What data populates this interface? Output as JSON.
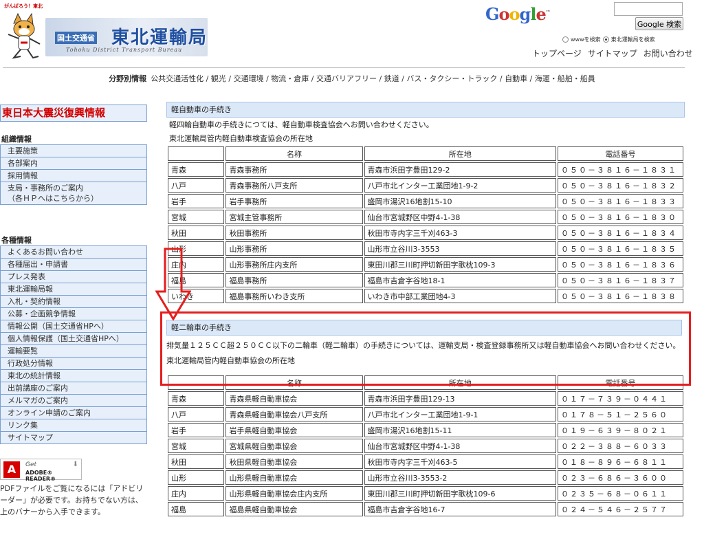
{
  "header": {
    "tagline": "がんばろう！東北",
    "logo_ministry": "国土交通省",
    "logo_name": "東北運輸局",
    "logo_english": "Tohoku District Transport Bureau",
    "google_logo": [
      "G",
      "o",
      "o",
      "g",
      "l",
      "e"
    ],
    "google_tm": "™",
    "search_placeholder": "",
    "search_button": "Google 検索",
    "search_option_www": "wwwを検索",
    "search_option_site": "東北運輸局を検索",
    "top_links": [
      "トップページ",
      "サイトマップ",
      "お問い合わせ"
    ]
  },
  "category_nav": {
    "label": "分野別情報",
    "items": [
      "公共交通活性化",
      "観光",
      "交通環境",
      "物流・倉庫",
      "交通バリアフリー",
      "鉄道",
      "バス・タクシー・トラック",
      "自動車",
      "海運・船舶・船員"
    ]
  },
  "sidebar": {
    "quake_banner": "東日本大震災復興情報",
    "groups": [
      {
        "title": "組織情報",
        "items": [
          "主要施策",
          "各部案内",
          "採用情報",
          "支局・事務所のご案内\n（各ＨＰへはこちらから）"
        ]
      },
      {
        "title": "各種情報",
        "items": [
          "よくあるお問い合わせ",
          "各種届出・申請書",
          "プレス発表",
          "東北運輸局報",
          "入札・契約情報",
          "公募・企画競争情報",
          "情報公開（国土交通省HPへ）",
          "個人情報保護（国土交通省HPへ）",
          "運輸要覧",
          "行政処分情報",
          "東北の統計情報",
          "出前講座のご案内",
          "メルマガのご案内",
          "オンライン申請のご案内",
          "リンク集",
          "サイトマップ"
        ]
      }
    ],
    "adobe": {
      "get": "Get",
      "reader": "ADOBE® READER®"
    },
    "pdf_note": "PDFファイルをご覧になるには「アドビリーダー」が必要です。お持ちでない方は、上のバナーから入手できます。"
  },
  "section1": {
    "title": "軽自動車の手続き",
    "note1": "軽四輪自動車の手続きにつては、軽自動車検査協会へお問い合わせください。",
    "note2": "東北運輸局管内軽自動車検査協会の所在地",
    "headers": [
      "",
      "名称",
      "所在地",
      "電話番号"
    ],
    "rows": [
      [
        "青森",
        "青森事務所",
        "青森市浜田字豊田129-2",
        "０５０－３８１６－１８３１"
      ],
      [
        "八戸",
        "青森事務所八戸支所",
        "八戸市北インター工業団地1-9-2",
        "０５０－３８１６－１８３２"
      ],
      [
        "岩手",
        "岩手事務所",
        "盛岡市湯沢16地割15-10",
        "０５０－３８１６－１８３３"
      ],
      [
        "宮城",
        "宮城主管事務所",
        "仙台市宮城野区中野4-1-38",
        "０５０－３８１６－１８３０"
      ],
      [
        "秋田",
        "秋田事務所",
        "秋田市寺内字三千刈463-3",
        "０５０－３８１６－１８３４"
      ],
      [
        "山形",
        "山形事務所",
        "山形市立谷川3-3553",
        "０５０－３８１６－１８３５"
      ],
      [
        "庄内",
        "山形事務所庄内支所",
        "東田川郡三川町押切新田字歌枕109-3",
        "０５０－３８１６－１８３６"
      ],
      [
        "福島",
        "福島事務所",
        "福島市吉倉字谷地18-1",
        "０５０－３８１６－１８３７"
      ],
      [
        "いわき",
        "福島事務所いわき支所",
        "いわき市中部工業団地4-3",
        "０５０－３８１６－１８３８"
      ]
    ]
  },
  "section2": {
    "title": "軽二輪車の手続き",
    "note1": "排気量１２５ＣＣ超２５０ＣＣ以下の二輪車（軽二輪車）の手続きについては、運輸支局・検査登録事務所又は軽自動車協会へお問い合わせください。",
    "note2": "東北運輸局管内軽自動車協会の所在地",
    "headers": [
      "",
      "名称",
      "所在地",
      "電話番号"
    ],
    "rows": [
      [
        "青森",
        "青森県軽自動車協会",
        "青森市浜田字豊田129-13",
        "０１７－７３９－０４４１"
      ],
      [
        "八戸",
        "青森県軽自動車協会八戸支所",
        "八戸市北インター工業団地1-9-1",
        "０１７８－５１－２５６０"
      ],
      [
        "岩手",
        "岩手県軽自動車協会",
        "盛岡市湯沢16地割15-11",
        "０１９－６３９－８０２１"
      ],
      [
        "宮城",
        "宮城県軽自動車協会",
        "仙台市宮城野区中野4-1-38",
        "０２２－３８８－６０３３"
      ],
      [
        "秋田",
        "秋田県軽自動車協会",
        "秋田市寺内字三千刈463-5",
        "０１８－８９６－６８１１"
      ],
      [
        "山形",
        "山形県軽自動車協会",
        "山形市立谷川3-3553-2",
        "０２３－６８６－３６００"
      ],
      [
        "庄内",
        "山形県軽自動車協会庄内支所",
        "東田川郡三川町押切新田字歌枕109-6",
        "０２３５－６８－０６１１"
      ],
      [
        "福島",
        "福島県軽自動車協会",
        "福島市吉倉字谷地16-7",
        "０２４－５４６－２５７７"
      ]
    ]
  },
  "colors": {
    "annotation_red": "#e41e1e",
    "section_head_bg": "#dbe8f7",
    "sidebar_item_bg": "#e6effa",
    "banner_text": "#d40000"
  }
}
